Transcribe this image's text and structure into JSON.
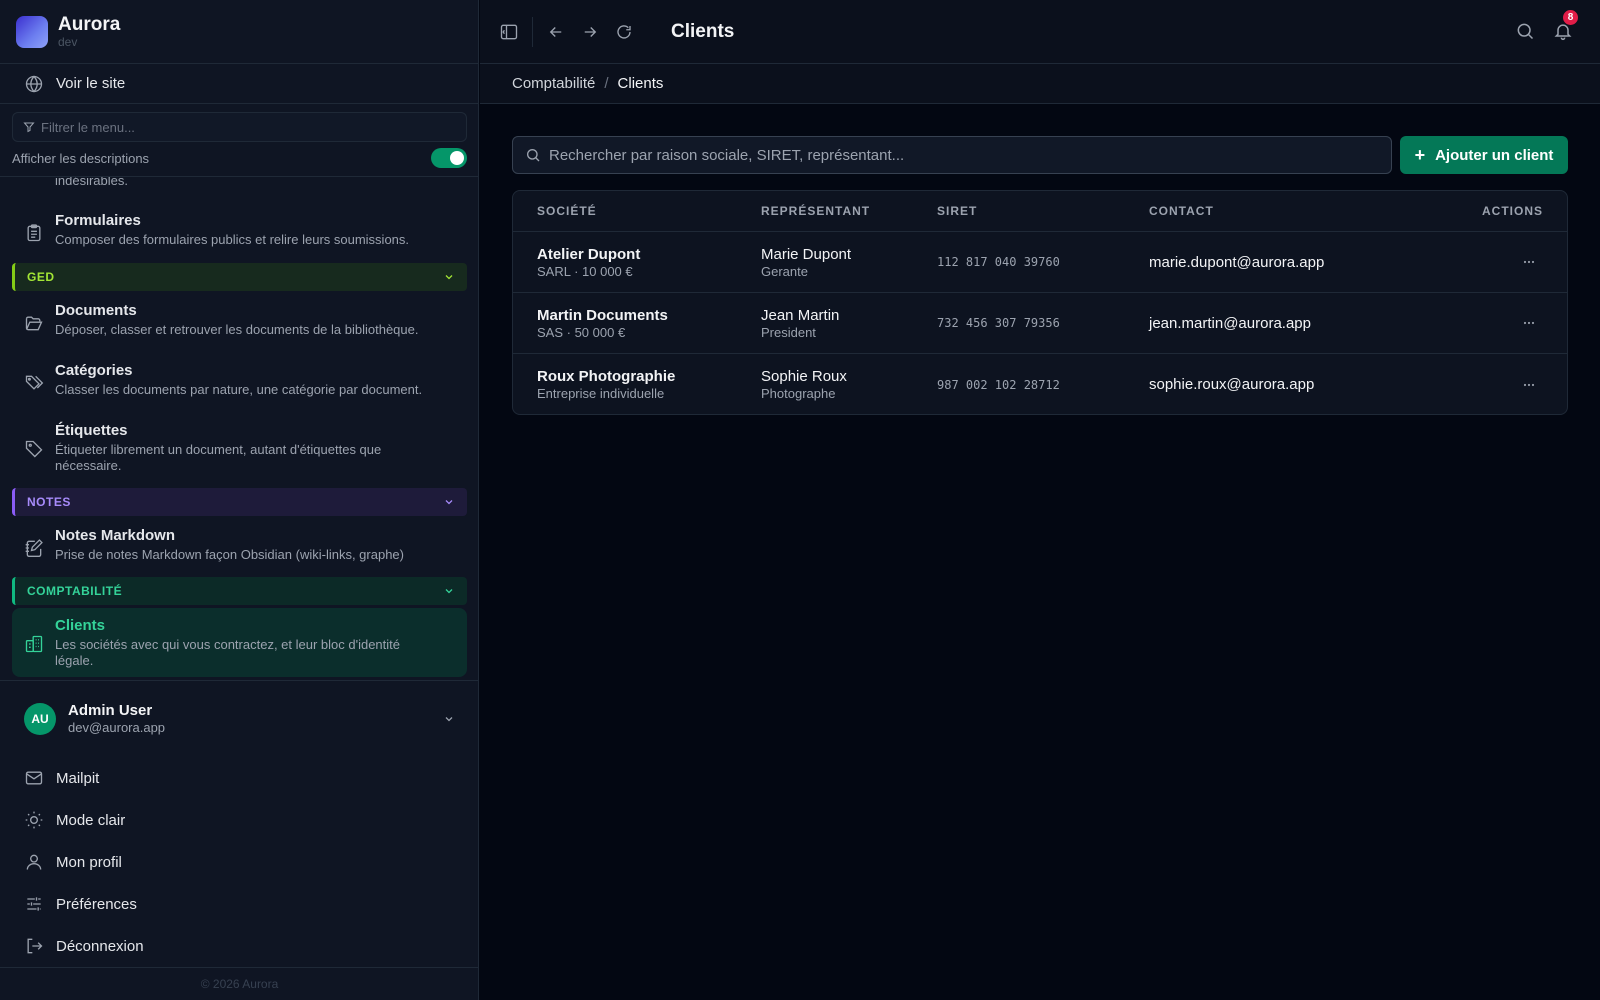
{
  "brand": {
    "name": "Aurora",
    "env": "dev"
  },
  "sidebar": {
    "view_site": "Voir le site",
    "filter_placeholder": "Filtrer le menu...",
    "show_descriptions": "Afficher les descriptions",
    "cut_text": "indésirables.",
    "items": {
      "formulaires": {
        "title": "Formulaires",
        "desc": "Composer des formulaires publics et relire leurs soumissions."
      },
      "documents": {
        "title": "Documents",
        "desc": "Déposer, classer et retrouver les documents de la bibliothèque."
      },
      "categories": {
        "title": "Catégories",
        "desc": "Classer les documents par nature, une catégorie par document."
      },
      "etiquettes": {
        "title": "Étiquettes",
        "desc": "Étiqueter librement un document, autant d'étiquettes que nécessaire."
      },
      "notes_markdown": {
        "title": "Notes Markdown",
        "desc": "Prise de notes Markdown façon Obsidian (wiki-links, graphe)"
      },
      "clients": {
        "title": "Clients",
        "desc": "Les sociétés avec qui vous contractez, et leur bloc d'identité légale."
      }
    },
    "sections": {
      "ged": "GED",
      "notes": "NOTES",
      "comptabilite": "COMPTABILITÉ"
    },
    "user": {
      "initials": "AU",
      "name": "Admin User",
      "email": "dev@aurora.app"
    },
    "links": {
      "mailpit": "Mailpit",
      "light_mode": "Mode clair",
      "profile": "Mon profil",
      "preferences": "Préférences",
      "logout": "Déconnexion"
    },
    "footer": "© 2026 Aurora"
  },
  "topbar": {
    "title": "Clients",
    "notification_count": "8"
  },
  "breadcrumb": {
    "parent": "Comptabilité",
    "current": "Clients"
  },
  "search": {
    "placeholder": "Rechercher par raison sociale, SIRET, représentant..."
  },
  "add_button": "Ajouter un client",
  "table": {
    "headers": {
      "company": "SOCIÉTÉ",
      "representative": "REPRÉSENTANT",
      "siret": "SIRET",
      "contact": "CONTACT",
      "actions": "ACTIONS"
    },
    "rows": [
      {
        "company": "Atelier Dupont",
        "company_sub": "SARL · 10 000 €",
        "rep": "Marie Dupont",
        "rep_role": "Gerante",
        "siret": "112 817 040 39760",
        "email": "marie.dupont@aurora.app"
      },
      {
        "company": "Martin Documents",
        "company_sub": "SAS · 50 000 €",
        "rep": "Jean Martin",
        "rep_role": "President",
        "siret": "732 456 307 79356",
        "email": "jean.martin@aurora.app"
      },
      {
        "company": "Roux Photographie",
        "company_sub": "Entreprise individuelle",
        "rep": "Sophie Roux",
        "rep_role": "Photographe",
        "siret": "987 002 102 28712",
        "email": "sophie.roux@aurora.app"
      }
    ]
  },
  "colors": {
    "accent": "#047857",
    "active": "#34d399",
    "badge": "#e11d48"
  }
}
